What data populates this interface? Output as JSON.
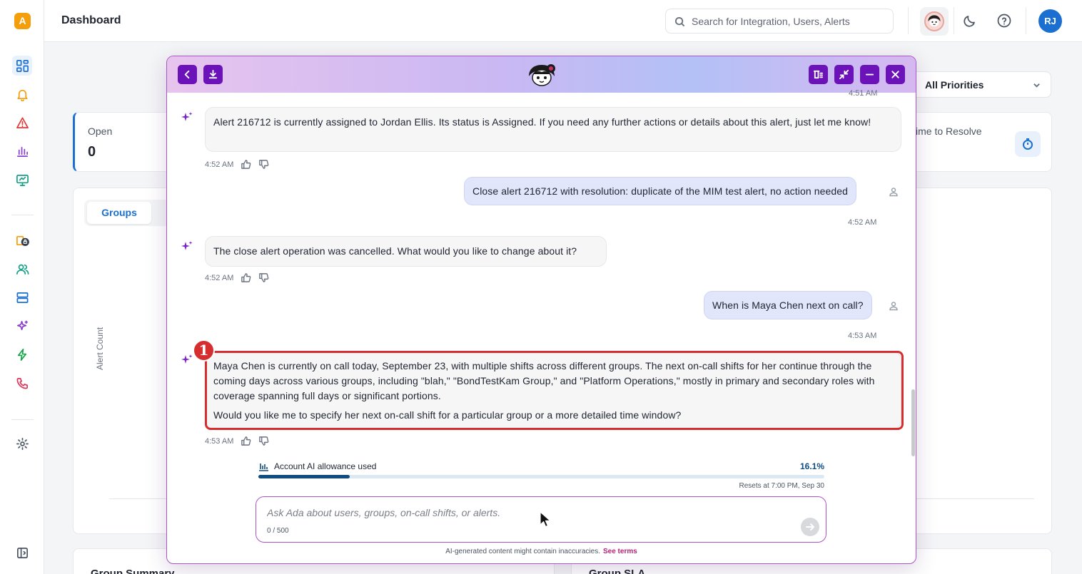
{
  "app": {
    "logo_letter": "A",
    "brand_color": "#f59e0b"
  },
  "header": {
    "title": "Dashboard",
    "search_placeholder": "Search for Integration, Users, Alerts",
    "avatar_initials": "RJ"
  },
  "sidebar": {
    "items": [
      {
        "icon": "dashboard-grid-icon",
        "active": true
      },
      {
        "icon": "bell-icon"
      },
      {
        "icon": "warning-triangle-icon"
      },
      {
        "icon": "bar-chart-icon"
      },
      {
        "icon": "monitor-icon"
      },
      {
        "icon": "locked-integrations-icon"
      },
      {
        "icon": "users-icon"
      },
      {
        "icon": "server-icon"
      },
      {
        "icon": "ai-sparkle-icon"
      },
      {
        "icon": "lightning-icon"
      },
      {
        "icon": "phone-icon"
      },
      {
        "icon": "gear-icon"
      },
      {
        "icon": "collapse-sidebar-icon"
      }
    ]
  },
  "dashboard": {
    "priority_filter": "All Priorities",
    "open": {
      "label": "Open",
      "value": "0"
    },
    "time_to_resolve_label": "ime to Resolve",
    "tab_active": "Groups",
    "y_axis_label": "Alert Count",
    "bottom_left_title": "Group Summary",
    "bottom_right_title": "Group SLA"
  },
  "chat": {
    "partial_time_top": "4:51 AM",
    "messages": [
      {
        "from": "ada",
        "text": "Alert 216712 is currently assigned to Jordan Ellis. Its status is Assigned. If you need any further actions or details about this alert, just let me know!",
        "time": "4:52 AM"
      },
      {
        "from": "user",
        "text": "Close alert 216712 with resolution: duplicate of the MIM test alert, no action needed",
        "time": "4:52 AM"
      },
      {
        "from": "ada",
        "text": "The close alert operation was cancelled. What would you like to change about it?",
        "time": "4:52 AM"
      },
      {
        "from": "user",
        "text": "When is Maya Chen next on call?",
        "time": "4:53 AM"
      },
      {
        "from": "ada",
        "text": "Maya Chen is currently on call today, September 23, with multiple shifts across different groups. The next on-call shifts for her continue through the coming days across various groups, including \"blah,\" \"BondTestKam Group,\" and \"Platform Operations,\" mostly in primary and secondary roles with coverage spanning full days or significant portions.",
        "text2": "Would you like me to specify her next on-call shift for a particular group or a more detailed time window?",
        "time": "4:53 AM"
      }
    ],
    "annotation_badge": "1",
    "allowance": {
      "label": "Account AI allowance used",
      "percent_label": "16.1%",
      "percent_value": 16.1,
      "reset_text": "Resets at 7:00 PM, Sep 30"
    },
    "input_placeholder": "Ask Ada about users, groups, on-call shifts, or alerts.",
    "char_counter": "0 / 500",
    "disclaimer": "AI-generated content might contain inaccuracies.",
    "terms_link": "See terms"
  }
}
